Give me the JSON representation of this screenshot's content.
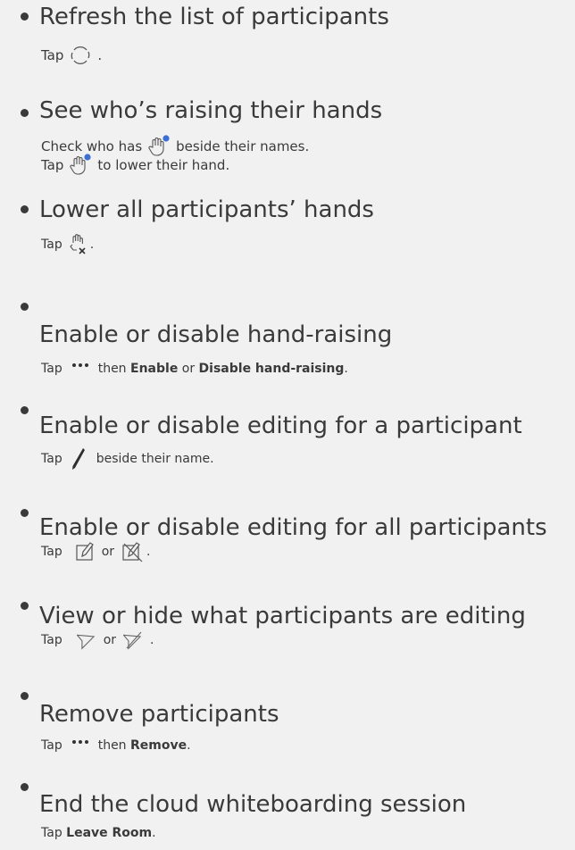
{
  "items": [
    {
      "title": "Refresh the list of participants",
      "tap": "Tap",
      "end": "."
    },
    {
      "title": "See who’s raising their hands",
      "line1a": "Check who has",
      "line1b": "beside their names.",
      "line2a": "Tap",
      "line2b": "to lower their hand."
    },
    {
      "title": "Lower all participants’ hands",
      "tap": "Tap",
      "end": "."
    },
    {
      "title": "Enable or disable hand-raising",
      "tap": "Tap",
      "then": "then",
      "bold1": "Enable",
      "or": "or",
      "bold2": "Disable hand-raising",
      "end": "."
    },
    {
      "title": "Enable or disable editing for a participant",
      "tap": "Tap",
      "rest": "beside their name."
    },
    {
      "title": "Enable or disable editing for all participants",
      "tap": "Tap",
      "or": "or",
      "end": "."
    },
    {
      "title": "View or hide what participants are editing",
      "tap": "Tap",
      "or": "or",
      "end": "."
    },
    {
      "title": "Remove participants",
      "tap": "Tap",
      "then": "then",
      "bold": "Remove",
      "end": "."
    },
    {
      "title": "End the cloud whiteboarding session",
      "tap": "Tap",
      "bold": "Leave Room",
      "end": "."
    }
  ],
  "icons": {
    "refresh": "refresh-icon",
    "raised_hand": "raised-hand-icon",
    "lower_all_hands": "lower-all-hands-icon",
    "more": "more-icon",
    "pen": "pen-icon",
    "enable_edit_all": "enable-edit-all-icon",
    "disable_edit_all": "disable-edit-all-icon",
    "view_editing": "view-editing-icon",
    "hide_editing": "hide-editing-icon"
  },
  "colors": {
    "text": "#3a3a3a",
    "accent": "#3b6fd6",
    "background": "#f1f1f1"
  }
}
